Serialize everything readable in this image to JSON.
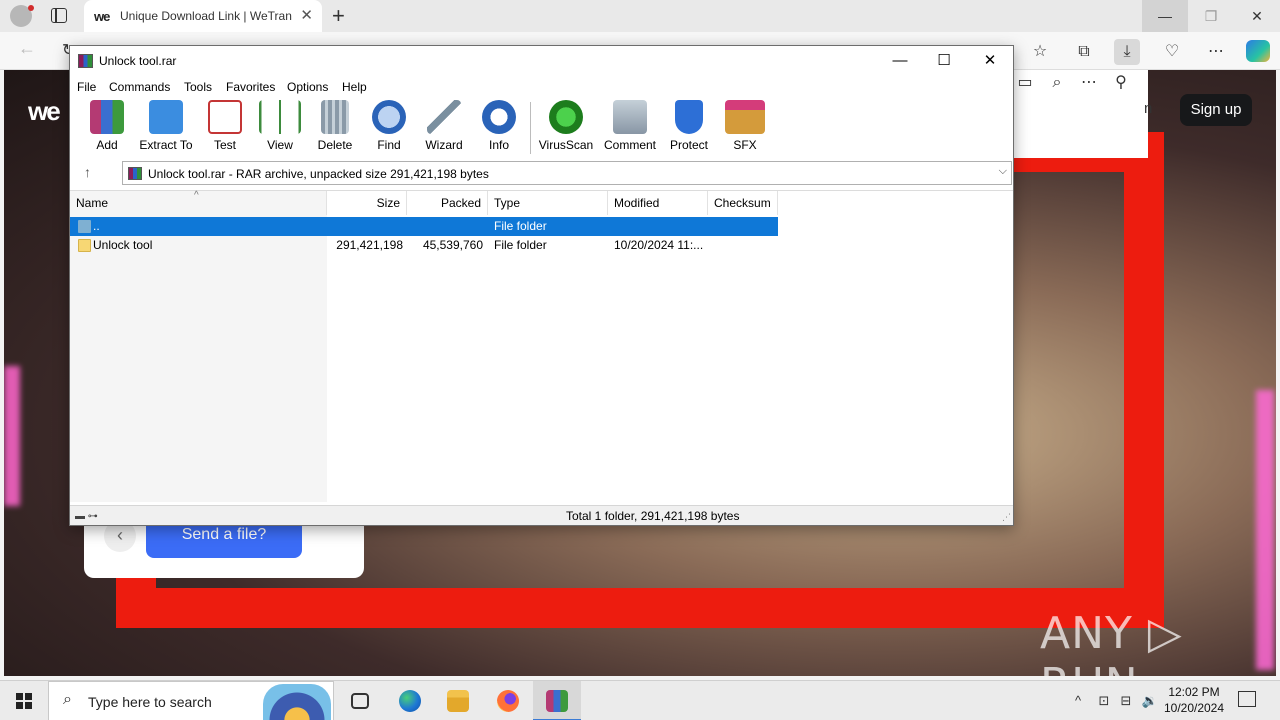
{
  "browser": {
    "tab_title": "Unique Download Link | WeTrans",
    "tab_favicon": "we",
    "close_tab": "✕",
    "new_tab": "+",
    "minimize": "—",
    "maximize": "❐",
    "close": "✕"
  },
  "webpage": {
    "logo": "we",
    "partial_button": "n",
    "signup": "Sign up",
    "send_file": "Send a file?",
    "back": "‹",
    "watermark": "ANY ▷ RUN"
  },
  "winrar": {
    "title": "Unlock tool.rar",
    "menu": [
      "File",
      "Commands",
      "Tools",
      "Favorites",
      "Options",
      "Help"
    ],
    "toolbar": [
      {
        "label": "Add",
        "icon": "add-icon",
        "color": "#b43a73"
      },
      {
        "label": "Extract To",
        "icon": "extract-to-icon",
        "color": "#3b8de0"
      },
      {
        "label": "Test",
        "icon": "test-icon",
        "color": "#c43535"
      },
      {
        "label": "View",
        "icon": "view-icon",
        "color": "#3d8b3d"
      },
      {
        "label": "Delete",
        "icon": "delete-icon",
        "color": "#8a9aa8"
      },
      {
        "label": "Find",
        "icon": "find-icon",
        "color": "#2a63b8"
      },
      {
        "label": "Wizard",
        "icon": "wizard-icon",
        "color": "#7a8f9f"
      },
      {
        "label": "Info",
        "icon": "info-icon",
        "color": "#2a63b8"
      },
      {
        "label": "VirusScan",
        "icon": "virusscan-icon",
        "color": "#2f9f2f"
      },
      {
        "label": "Comment",
        "icon": "comment-icon",
        "color": "#8896a5"
      },
      {
        "label": "Protect",
        "icon": "protect-icon",
        "color": "#2d6fd6"
      },
      {
        "label": "SFX",
        "icon": "sfx-icon",
        "color": "#d49b3b"
      }
    ],
    "path": "Unlock tool.rar - RAR archive, unpacked size 291,421,198 bytes",
    "columns": [
      "Name",
      "Size",
      "Packed",
      "Type",
      "Modified",
      "Checksum"
    ],
    "rows": [
      {
        "name": "..",
        "size": "",
        "packed": "",
        "type": "File folder",
        "modified": "",
        "checksum": "",
        "selected": true
      },
      {
        "name": "Unlock tool",
        "size": "291,421,198",
        "packed": "45,539,760",
        "type": "File folder",
        "modified": "10/20/2024 11:...",
        "checksum": "",
        "selected": false
      }
    ],
    "status": "Total 1 folder, 291,421,198 bytes"
  },
  "taskbar": {
    "search_placeholder": "Type here to search",
    "time": "12:02 PM",
    "date": "10/20/2024"
  }
}
